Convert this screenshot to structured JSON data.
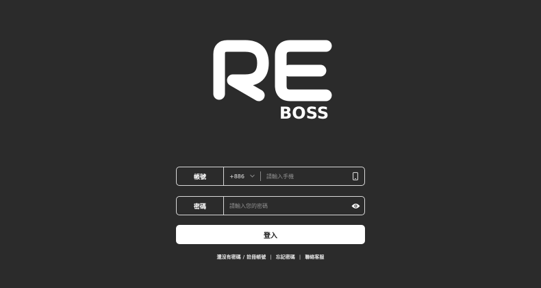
{
  "brand": {
    "logo_letters": "RE",
    "sub_text": "BOSS"
  },
  "account_field": {
    "label": "帳號",
    "country_code": "+886",
    "placeholder": "請輸入手機",
    "trailing_icon": "smartphone-icon"
  },
  "password_field": {
    "label": "密碼",
    "placeholder": "請輸入您的密碼",
    "trailing_icon": "eye-icon"
  },
  "login_button": {
    "label": "登入"
  },
  "links": {
    "no_password": "還沒有密碼",
    "slash": "/",
    "register": "註冊帳號",
    "separator": "|",
    "forgot": "忘記密碼",
    "contact": "聯絡客服"
  },
  "colors": {
    "background": "#2b2b2b",
    "foreground": "#ffffff",
    "border": "#d9d9d9"
  }
}
